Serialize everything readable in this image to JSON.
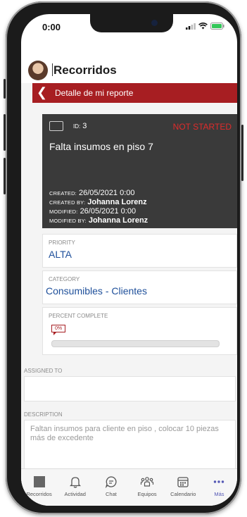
{
  "status_bar": {
    "time": "0:00"
  },
  "header": {
    "title": "Recorridos"
  },
  "nav": {
    "back_label": "Detalle de mi reporte"
  },
  "ticket": {
    "id_label": "ID:",
    "id": "3",
    "status": "NOT STARTED",
    "title": "Falta insumos en piso 7",
    "created_label": "CREATED:",
    "created": "26/05/2021 0:00",
    "created_by_label": "CREATED BY:",
    "created_by": "Johanna Lorenz",
    "modified_label": "MODIFIED:",
    "modified": "26/05/2021 0:00",
    "modified_by_label": "MODIFIED BY:",
    "modified_by": "Johanna Lorenz"
  },
  "priority": {
    "label": "PRIORITY",
    "value": "ALTA"
  },
  "category": {
    "label": "CATEGORY",
    "value": "Consumibles - Clientes"
  },
  "percent": {
    "label": "PERCENT COMPLETE",
    "value_text": "0%",
    "value": 0
  },
  "assigned": {
    "label": "ASSIGNED TO",
    "value": ""
  },
  "description": {
    "label": "DESCRIPTION",
    "value": "Faltan insumos para cliente en piso , colocar 10 piezas más de excedente"
  },
  "tabs": [
    {
      "label": "Recorridos",
      "icon": "recorridos-icon"
    },
    {
      "label": "Actividad",
      "icon": "bell-icon"
    },
    {
      "label": "Chat",
      "icon": "chat-icon"
    },
    {
      "label": "Equipos",
      "icon": "teams-icon"
    },
    {
      "label": "Calendario",
      "icon": "calendar-icon"
    },
    {
      "label": "Más",
      "icon": "more-icon"
    }
  ],
  "colors": {
    "brand_red": "#a71e22",
    "link_blue": "#1e4f9a",
    "card_bg": "#3a3a3a",
    "status_red": "#e02b2b",
    "more_purple": "#5559b5"
  }
}
